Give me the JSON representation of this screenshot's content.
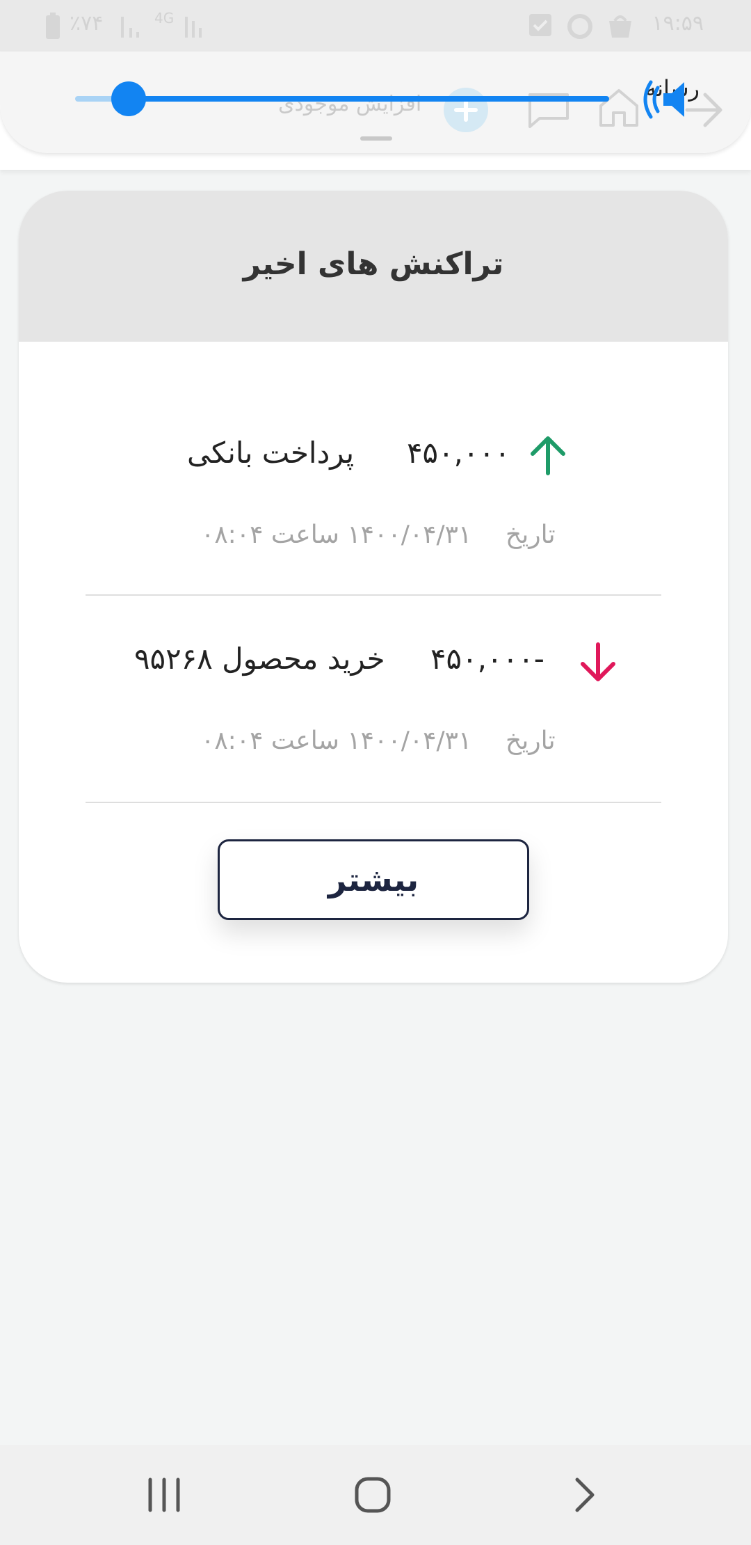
{
  "status_bar": {
    "time": "۱۹:۵۹",
    "battery_percent": "٪۷۴",
    "network": "4G"
  },
  "volume_panel": {
    "label": "رسانه",
    "level": 0.1,
    "accent_color": "#1284f2",
    "icon": "speaker-icon"
  },
  "app_bar_behind": {
    "add_balance_label": "افزایش موجودی"
  },
  "transactions": {
    "title": "تراکنش های اخیر",
    "items": [
      {
        "direction": "up",
        "amount": "۴۵۰,۰۰۰",
        "description": "پرداخت بانکی",
        "date_label": "تاریخ",
        "date": "۱۴۰۰/۰۴/۳۱ ساعت ۰۸:۰۴",
        "arrow_color": "#1e9b68"
      },
      {
        "direction": "down",
        "amount": "-۴۵۰,۰۰۰",
        "description": "خرید محصول ۹۵۲۶۸",
        "date_label": "تاریخ",
        "date": "۱۴۰۰/۰۴/۳۱ ساعت ۰۸:۰۴",
        "arrow_color": "#e0185a"
      }
    ],
    "more_label": "بیشتر"
  },
  "nav_bar": {
    "recent_icon": "recent-apps-icon",
    "home_icon": "home-icon",
    "back_icon": "back-icon"
  }
}
